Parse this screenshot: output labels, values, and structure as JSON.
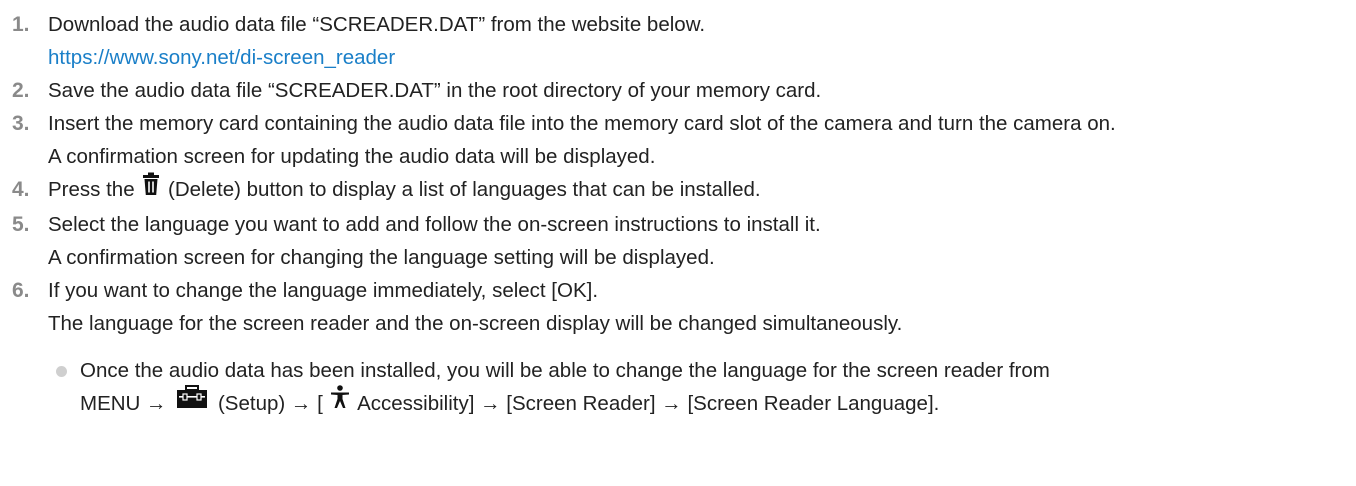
{
  "steps": [
    {
      "number": "1.",
      "text": "Download the audio data file “SCREADER.DAT” from the website below.",
      "link": "https://www.sony.net/di-screen_reader"
    },
    {
      "number": "2.",
      "text": "Save the audio data file “SCREADER.DAT” in the root directory of your memory card."
    },
    {
      "number": "3.",
      "text": "Insert the memory card containing the audio data file into the memory card slot of the camera and turn the camera on.",
      "sub": "A confirmation screen for updating the audio data will be displayed."
    },
    {
      "number": "4.",
      "text_before": "Press the",
      "icon": "delete-trash-icon",
      "text_after": "(Delete) button to display a list of languages that can be installed."
    },
    {
      "number": "5.",
      "text": "Select the language you want to add and follow the on-screen instructions to install it.",
      "sub": "A confirmation screen for changing the language setting will be displayed."
    },
    {
      "number": "6.",
      "text": "If you want to change the language immediately, select [OK].",
      "sub": "The language for the screen reader and the on-screen display will be changed simultaneously."
    }
  ],
  "note": {
    "line1": "Once the audio data has been installed, you will be able to change the language for the screen reader from",
    "menu": "MENU →",
    "setup_icon": "toolbox-setup-icon",
    "setup_label": "(Setup) → [",
    "accessibility_icon": "accessibility-person-icon",
    "accessibility_label": "Accessibility] → [Screen Reader] → [Screen Reader Language]."
  },
  "colors": {
    "text": "#222222",
    "numbers": "#8a8a8a",
    "link": "#1a7fc8",
    "bullet": "#cfcfcf"
  }
}
